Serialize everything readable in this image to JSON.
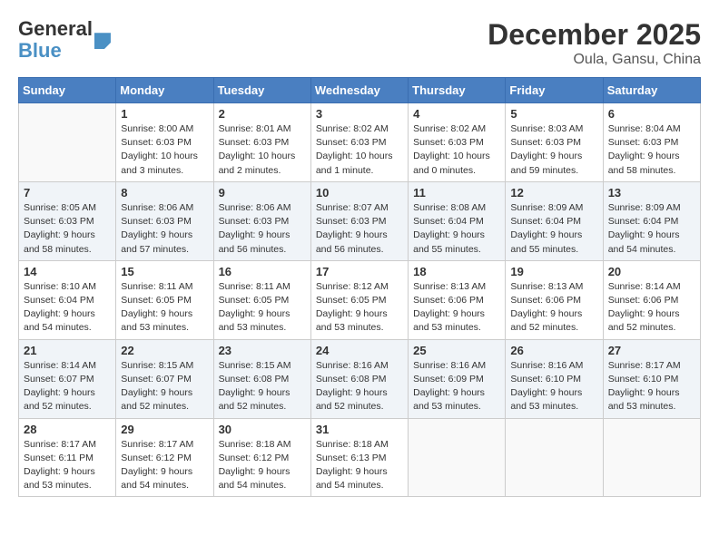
{
  "header": {
    "logo_line1": "General",
    "logo_line2": "Blue",
    "title": "December 2025",
    "subtitle": "Oula, Gansu, China"
  },
  "days_of_week": [
    "Sunday",
    "Monday",
    "Tuesday",
    "Wednesday",
    "Thursday",
    "Friday",
    "Saturday"
  ],
  "weeks": [
    {
      "shaded": false,
      "days": [
        {
          "num": "",
          "info": ""
        },
        {
          "num": "1",
          "info": "Sunrise: 8:00 AM\nSunset: 6:03 PM\nDaylight: 10 hours\nand 3 minutes."
        },
        {
          "num": "2",
          "info": "Sunrise: 8:01 AM\nSunset: 6:03 PM\nDaylight: 10 hours\nand 2 minutes."
        },
        {
          "num": "3",
          "info": "Sunrise: 8:02 AM\nSunset: 6:03 PM\nDaylight: 10 hours\nand 1 minute."
        },
        {
          "num": "4",
          "info": "Sunrise: 8:02 AM\nSunset: 6:03 PM\nDaylight: 10 hours\nand 0 minutes."
        },
        {
          "num": "5",
          "info": "Sunrise: 8:03 AM\nSunset: 6:03 PM\nDaylight: 9 hours\nand 59 minutes."
        },
        {
          "num": "6",
          "info": "Sunrise: 8:04 AM\nSunset: 6:03 PM\nDaylight: 9 hours\nand 58 minutes."
        }
      ]
    },
    {
      "shaded": true,
      "days": [
        {
          "num": "7",
          "info": "Sunrise: 8:05 AM\nSunset: 6:03 PM\nDaylight: 9 hours\nand 58 minutes."
        },
        {
          "num": "8",
          "info": "Sunrise: 8:06 AM\nSunset: 6:03 PM\nDaylight: 9 hours\nand 57 minutes."
        },
        {
          "num": "9",
          "info": "Sunrise: 8:06 AM\nSunset: 6:03 PM\nDaylight: 9 hours\nand 56 minutes."
        },
        {
          "num": "10",
          "info": "Sunrise: 8:07 AM\nSunset: 6:03 PM\nDaylight: 9 hours\nand 56 minutes."
        },
        {
          "num": "11",
          "info": "Sunrise: 8:08 AM\nSunset: 6:04 PM\nDaylight: 9 hours\nand 55 minutes."
        },
        {
          "num": "12",
          "info": "Sunrise: 8:09 AM\nSunset: 6:04 PM\nDaylight: 9 hours\nand 55 minutes."
        },
        {
          "num": "13",
          "info": "Sunrise: 8:09 AM\nSunset: 6:04 PM\nDaylight: 9 hours\nand 54 minutes."
        }
      ]
    },
    {
      "shaded": false,
      "days": [
        {
          "num": "14",
          "info": "Sunrise: 8:10 AM\nSunset: 6:04 PM\nDaylight: 9 hours\nand 54 minutes."
        },
        {
          "num": "15",
          "info": "Sunrise: 8:11 AM\nSunset: 6:05 PM\nDaylight: 9 hours\nand 53 minutes."
        },
        {
          "num": "16",
          "info": "Sunrise: 8:11 AM\nSunset: 6:05 PM\nDaylight: 9 hours\nand 53 minutes."
        },
        {
          "num": "17",
          "info": "Sunrise: 8:12 AM\nSunset: 6:05 PM\nDaylight: 9 hours\nand 53 minutes."
        },
        {
          "num": "18",
          "info": "Sunrise: 8:13 AM\nSunset: 6:06 PM\nDaylight: 9 hours\nand 53 minutes."
        },
        {
          "num": "19",
          "info": "Sunrise: 8:13 AM\nSunset: 6:06 PM\nDaylight: 9 hours\nand 52 minutes."
        },
        {
          "num": "20",
          "info": "Sunrise: 8:14 AM\nSunset: 6:06 PM\nDaylight: 9 hours\nand 52 minutes."
        }
      ]
    },
    {
      "shaded": true,
      "days": [
        {
          "num": "21",
          "info": "Sunrise: 8:14 AM\nSunset: 6:07 PM\nDaylight: 9 hours\nand 52 minutes."
        },
        {
          "num": "22",
          "info": "Sunrise: 8:15 AM\nSunset: 6:07 PM\nDaylight: 9 hours\nand 52 minutes."
        },
        {
          "num": "23",
          "info": "Sunrise: 8:15 AM\nSunset: 6:08 PM\nDaylight: 9 hours\nand 52 minutes."
        },
        {
          "num": "24",
          "info": "Sunrise: 8:16 AM\nSunset: 6:08 PM\nDaylight: 9 hours\nand 52 minutes."
        },
        {
          "num": "25",
          "info": "Sunrise: 8:16 AM\nSunset: 6:09 PM\nDaylight: 9 hours\nand 53 minutes."
        },
        {
          "num": "26",
          "info": "Sunrise: 8:16 AM\nSunset: 6:10 PM\nDaylight: 9 hours\nand 53 minutes."
        },
        {
          "num": "27",
          "info": "Sunrise: 8:17 AM\nSunset: 6:10 PM\nDaylight: 9 hours\nand 53 minutes."
        }
      ]
    },
    {
      "shaded": false,
      "days": [
        {
          "num": "28",
          "info": "Sunrise: 8:17 AM\nSunset: 6:11 PM\nDaylight: 9 hours\nand 53 minutes."
        },
        {
          "num": "29",
          "info": "Sunrise: 8:17 AM\nSunset: 6:12 PM\nDaylight: 9 hours\nand 54 minutes."
        },
        {
          "num": "30",
          "info": "Sunrise: 8:18 AM\nSunset: 6:12 PM\nDaylight: 9 hours\nand 54 minutes."
        },
        {
          "num": "31",
          "info": "Sunrise: 8:18 AM\nSunset: 6:13 PM\nDaylight: 9 hours\nand 54 minutes."
        },
        {
          "num": "",
          "info": ""
        },
        {
          "num": "",
          "info": ""
        },
        {
          "num": "",
          "info": ""
        }
      ]
    }
  ]
}
